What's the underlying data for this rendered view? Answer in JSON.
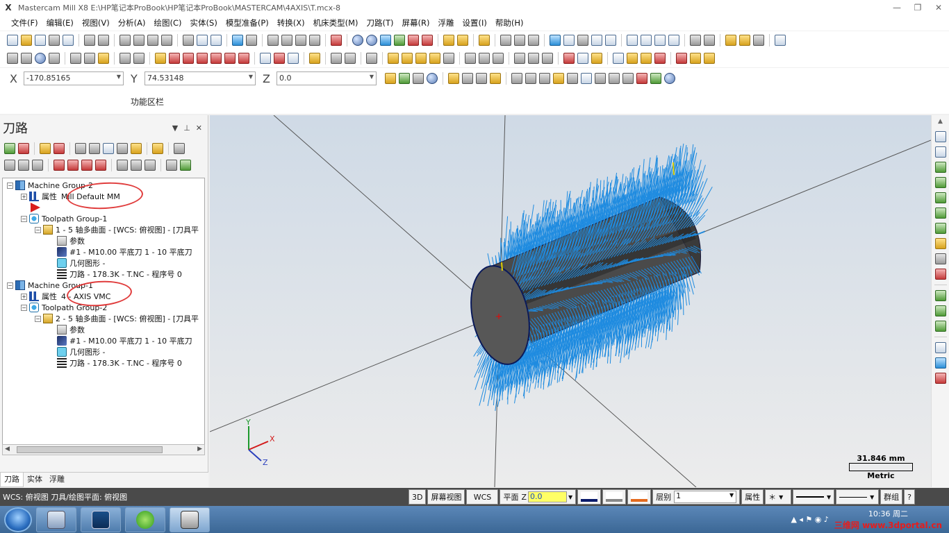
{
  "window": {
    "title": "Mastercam Mill X8  E:\\HP笔记本ProBook\\HP笔记本ProBook\\MASTERCAM\\4AXIS\\T.mcx-8",
    "logo": "X",
    "min": "—",
    "max": "❐",
    "close": "✕"
  },
  "menu": [
    "文件(F)",
    "编辑(E)",
    "视图(V)",
    "分析(A)",
    "绘图(C)",
    "实体(S)",
    "模型准备(P)",
    "转换(X)",
    "机床类型(M)",
    "刀路(T)",
    "屏幕(R)",
    "浮雕",
    "设置(I)",
    "帮助(H)"
  ],
  "coords": {
    "x_label": "X",
    "x_value": "-170.85165",
    "y_label": "Y",
    "y_value": "74.53148",
    "z_label": "Z",
    "z_value": "0.0"
  },
  "function_area": "功能区栏",
  "panel": {
    "title": "刀路",
    "tree": {
      "mg2": "Machine Group-2",
      "mg2_props_label": "属性",
      "mg2_props_value": "Mill Default MM",
      "tg1": "Toolpath Group-1",
      "op1": "1 - 5 轴多曲面 - [WCS: 俯视图] - [刀具平",
      "op1_params": "参数",
      "op1_tool": "#1 - M10.00 平底刀 1 - 10 平底刀",
      "op1_geo": "几何图形 -",
      "op1_path": "刀路 - 178.3K - T.NC - 程序号 0",
      "mg1": "Machine Group-1",
      "mg1_props_label": "属性",
      "mg1_props_value": "4 - AXIS VMC",
      "tg2": "Toolpath Group-2",
      "op2": "2 - 5 轴多曲面 - [WCS: 俯视图] - [刀具平",
      "op2_params": "参数",
      "op2_tool": "#1 - M10.00 平底刀 1 - 10 平底刀",
      "op2_geo": "几何图形 -",
      "op2_path": "刀路 - 178.3K - T.NC - 程序号 0"
    },
    "tabs": [
      "刀路",
      "实体",
      "浮雕"
    ]
  },
  "viewport": {
    "scale": "31.846 mm",
    "units": "Metric",
    "axis_x": "X",
    "axis_y": "Y",
    "axis_z": "Z"
  },
  "statusbar": {
    "wcs": "WCS: 俯视图  刀具/绘图平面: 俯视图",
    "btn_3d": "3D",
    "btn_view": "屏幕视图",
    "btn_wcs": "WCS",
    "btn_plane": "平面",
    "z_label": "Z",
    "z_value": "0.0",
    "level_label": "层别",
    "level_value": "1",
    "attr": "属性",
    "group": "群组",
    "help": "?"
  },
  "taskbar": {
    "time": "10:36 周二",
    "watermark": "三维网 www.3dportal.cn"
  },
  "colors": {
    "toolpath": "#1e8be0",
    "cylinder": "#3d3d3d",
    "annotation": "#e03c3c",
    "statusbar": "#4a4a4a",
    "taskbar": "#4e7cad"
  }
}
